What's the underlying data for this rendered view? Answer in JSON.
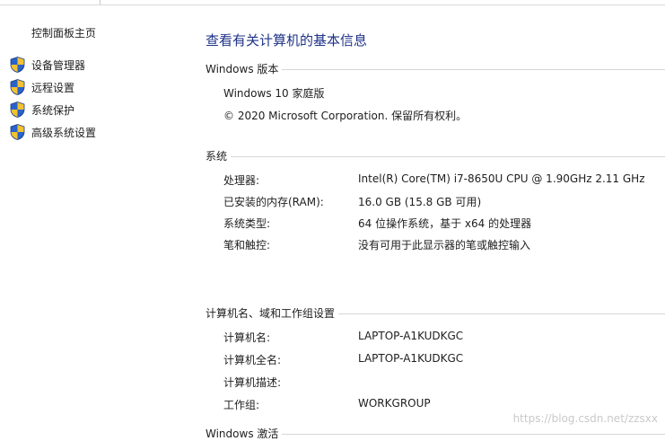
{
  "sidebar": {
    "home_label": "控制面板主页",
    "items": [
      {
        "label": "设备管理器",
        "icon": "uac-shield-icon"
      },
      {
        "label": "远程设置",
        "icon": "uac-shield-icon"
      },
      {
        "label": "系统保护",
        "icon": "uac-shield-icon"
      },
      {
        "label": "高级系统设置",
        "icon": "uac-shield-icon"
      }
    ]
  },
  "main": {
    "title": "查看有关计算机的基本信息",
    "windows_edition": {
      "header": "Windows 版本",
      "edition": "Windows 10 家庭版",
      "copyright": "© 2020 Microsoft Corporation. 保留所有权利。"
    },
    "system": {
      "header": "系统",
      "rows": [
        {
          "label": "处理器:",
          "value": "Intel(R) Core(TM) i7-8650U CPU @ 1.90GHz   2.11 GHz"
        },
        {
          "label": "已安装的内存(RAM):",
          "value": "16.0 GB (15.8 GB 可用)"
        },
        {
          "label": "系统类型:",
          "value": "64 位操作系统，基于 x64 的处理器"
        },
        {
          "label": "笔和触控:",
          "value": "没有可用于此显示器的笔或触控输入"
        }
      ]
    },
    "computer_name": {
      "header": "计算机名、域和工作组设置",
      "rows": [
        {
          "label": "计算机名:",
          "value": "LAPTOP-A1KUDKGC"
        },
        {
          "label": "计算机全名:",
          "value": "LAPTOP-A1KUDKGC"
        },
        {
          "label": "计算机描述:",
          "value": ""
        },
        {
          "label": "工作组:",
          "value": "WORKGROUP"
        }
      ]
    },
    "activation": {
      "header": "Windows 激活"
    }
  },
  "watermark": "https://blog.csdn.net/zzsxx",
  "colors": {
    "title_blue": "#1e3287",
    "rule_gray": "#d6d6d6",
    "shield_blue": "#2a62c9",
    "shield_yellow": "#f2c230"
  }
}
